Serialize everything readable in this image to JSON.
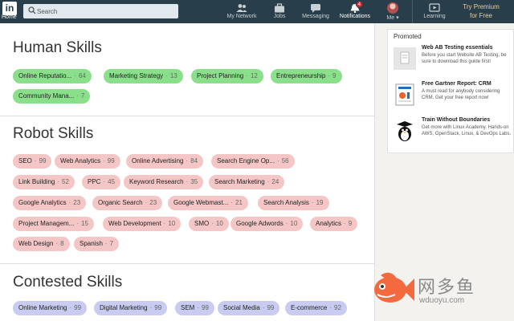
{
  "nav": {
    "logo_text": "in",
    "home_label": "Home",
    "search_placeholder": "Search",
    "items": [
      {
        "label": "My Network",
        "icon": "people-icon"
      },
      {
        "label": "Jobs",
        "icon": "briefcase-icon"
      },
      {
        "label": "Messaging",
        "icon": "chat-icon"
      },
      {
        "label": "Notifications",
        "icon": "bell-icon",
        "badge": "4"
      },
      {
        "label": "Me",
        "icon": "avatar"
      },
      {
        "label": "Learning",
        "icon": "learning-icon"
      }
    ],
    "premium_line1": "Try Premium",
    "premium_line2": "for Free"
  },
  "skills": {
    "human": {
      "title": "Human Skills",
      "chips": [
        {
          "name": "Online Reputatio...",
          "count": "64"
        },
        {
          "name": "Marketing Strategy",
          "count": "13"
        },
        {
          "name": "Project Planning",
          "count": "12"
        },
        {
          "name": "Entrepreneurship",
          "count": "9"
        },
        {
          "name": "Community Mana...",
          "count": "7"
        }
      ]
    },
    "robot": {
      "title": "Robot Skills",
      "chips": [
        {
          "name": "SEO",
          "count": "99"
        },
        {
          "name": "Web Analytics",
          "count": "99"
        },
        {
          "name": "Online Advertising",
          "count": "84"
        },
        {
          "name": "Search Engine Op...",
          "count": "56"
        },
        {
          "name": "Link Building",
          "count": "52"
        },
        {
          "name": "PPC",
          "count": "45"
        },
        {
          "name": "Keyword Research",
          "count": "35"
        },
        {
          "name": "Search Marketing",
          "count": "24"
        },
        {
          "name": "Google Analytics",
          "count": "23"
        },
        {
          "name": "Organic Search",
          "count": "23"
        },
        {
          "name": "Google Webmast...",
          "count": "21"
        },
        {
          "name": "Search Analysis",
          "count": "19"
        },
        {
          "name": "Project Managem...",
          "count": "15"
        },
        {
          "name": "Web Development",
          "count": "10"
        },
        {
          "name": "SMO",
          "count": "10"
        },
        {
          "name": "Google Adwords",
          "count": "10"
        },
        {
          "name": "Analytics",
          "count": "9"
        },
        {
          "name": "Web Design",
          "count": "8"
        },
        {
          "name": "Spanish",
          "count": "7"
        }
      ]
    },
    "contested": {
      "title": "Contested Skills",
      "chips": [
        {
          "name": "Online Marketing",
          "count": "99"
        },
        {
          "name": "Digital Marketing",
          "count": "99"
        },
        {
          "name": "SEM",
          "count": "99"
        },
        {
          "name": "Social Media",
          "count": "99"
        },
        {
          "name": "E-commerce",
          "count": "92"
        }
      ]
    }
  },
  "promoted": {
    "title": "Promoted",
    "ads": [
      {
        "headline": "Web AB Testing essentials",
        "body": "Before you start Website AB Testing, be sure to download this guide first!"
      },
      {
        "headline": "Free Gartner Report: CRM",
        "body": "A must read for anybody considering CRM. Get your free report now!"
      },
      {
        "headline": "Train Without Boundaries",
        "body": "Get more with Linux Academy. Hands-on AWS, OpenStack, Linux, & DevOps Labs."
      }
    ]
  },
  "watermark": {
    "cn_text": "网多鱼",
    "url": "wduoyu.com"
  },
  "colors": {
    "nav_bg": "#283e4a",
    "human_chip": "#8ae08a",
    "robot_chip": "#f5c6c6",
    "contested_chip": "#c9cbf0",
    "badge": "#e0242f"
  }
}
